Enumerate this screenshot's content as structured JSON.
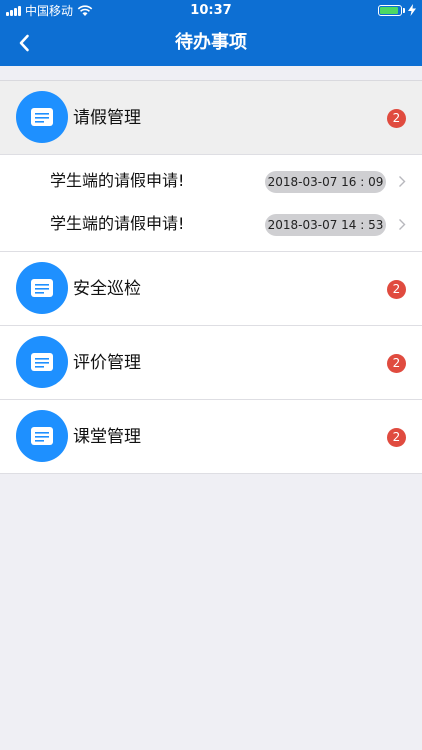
{
  "status_bar": {
    "carrier": "中国移动",
    "time": "10:37",
    "signal_icon": "signal-bars-icon",
    "wifi_icon": "wifi-icon",
    "battery_icon": "battery-icon",
    "charge_icon": "charging-bolt-icon"
  },
  "nav": {
    "title": "待办事项",
    "back_icon": "chevron-left-icon"
  },
  "colors": {
    "header": "#0d6fd3",
    "avatar": "#1e90ff",
    "badge": "#e04b3f",
    "background": "#efeff4",
    "time_pill": "#cfcfd2"
  },
  "groups": [
    {
      "title": "请假管理",
      "badge": "2",
      "expanded": true,
      "items": [
        {
          "title": "学生端的请假申请!",
          "time": "2018-03-07 16 : 09"
        },
        {
          "title": "学生端的请假申请!",
          "time": "2018-03-07 14 : 53"
        }
      ]
    },
    {
      "title": "安全巡检",
      "badge": "2"
    },
    {
      "title": "评价管理",
      "badge": "2"
    },
    {
      "title": "课堂管理",
      "badge": "2"
    }
  ]
}
